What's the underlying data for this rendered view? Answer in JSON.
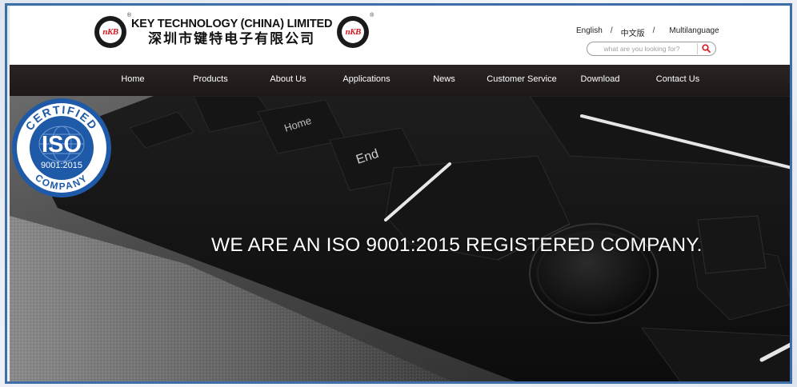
{
  "header": {
    "company_en": "KEY TECHNOLOGY (CHINA) LIMITED",
    "company_cn": "深圳市键特电子有限公司",
    "logo_mark": "nKB",
    "registered_mark": "®"
  },
  "languages": {
    "english": "English",
    "separator": "/",
    "chinese": "中文版",
    "multi": "Multilanguage"
  },
  "search": {
    "placeholder": "what are you looking for?",
    "icon": "search-icon"
  },
  "nav": {
    "items": [
      "Home",
      "Products",
      "About Us",
      "Applications",
      "News",
      "Customer Service",
      "Download",
      "Contact Us"
    ]
  },
  "banner": {
    "headline": "WE ARE AN ISO 9001:2015 REGISTERED COMPANY.",
    "badge": {
      "top_arc": "CERTIFIED",
      "center": "ISO",
      "standard": "9001:2015",
      "bottom_arc": "COMPANY"
    },
    "keys": {
      "home": "Home",
      "end": "End"
    }
  },
  "colors": {
    "nav_bg": "#221c1c",
    "brand_red": "#d8181f",
    "iso_blue": "#1f5aa8",
    "frame_blue": "#3d6ea8",
    "search_icon": "#d8181f"
  }
}
